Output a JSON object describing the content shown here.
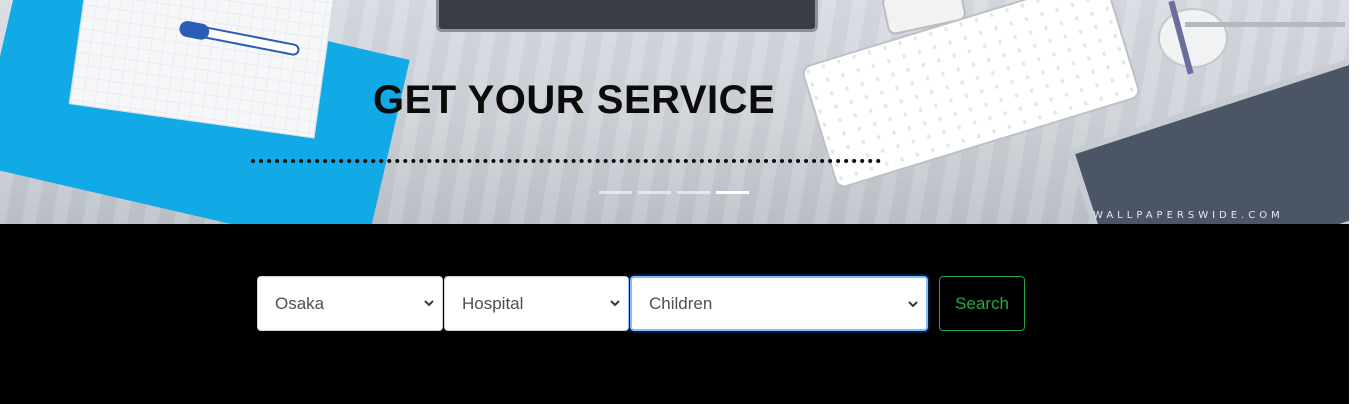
{
  "hero": {
    "title": "GET YOUR SERVICE",
    "watermark": "WALLPAPERSWIDE.COM",
    "slides_total": 4,
    "active_slide": 4
  },
  "search": {
    "city": {
      "selected": "Osaka"
    },
    "facility": {
      "selected": "Hospital"
    },
    "specialty": {
      "selected": "Children"
    },
    "button_label": "Search"
  },
  "colors": {
    "search_band": "#000000",
    "button_outline": "#28a745",
    "focus_ring": "#80bdff",
    "folder": "#11a9e6"
  }
}
